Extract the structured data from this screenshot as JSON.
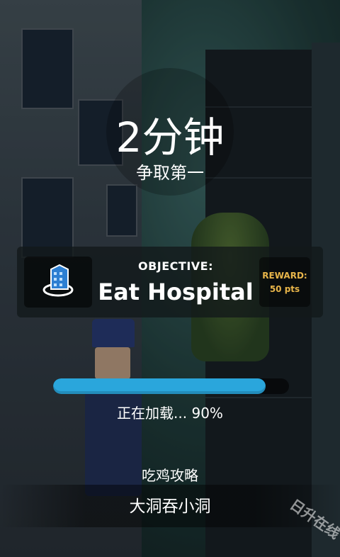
{
  "timer": {
    "value": "2分钟",
    "subtitle": "争取第一"
  },
  "objective": {
    "label": "OBJECTIVE:",
    "title": "Eat Hospital",
    "icon": "hospital-building-icon"
  },
  "reward": {
    "label": "REWARD:",
    "value": "50 pts"
  },
  "loading": {
    "progress": 0.9,
    "text": "正在加载... 90%"
  },
  "tip": {
    "title": "吃鸡攻略",
    "text": "大洞吞小洞"
  },
  "watermark": "日升在线",
  "colors": {
    "progress_fill": "#2aa6dc",
    "reward_text": "#e8b54a",
    "panel_bg": "#12181a"
  }
}
